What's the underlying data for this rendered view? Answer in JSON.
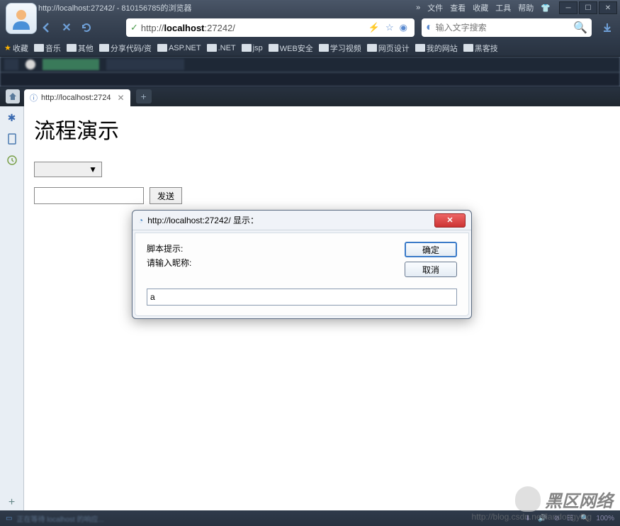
{
  "window": {
    "title": "http://localhost:27242/ - 810156785的浏览器"
  },
  "menu": {
    "arrow": "»",
    "file": "文件",
    "view": "查看",
    "favorites": "收藏",
    "tools": "工具",
    "help": "帮助"
  },
  "address": {
    "prefix": "http://",
    "host": "localhost",
    "rest": ":27242/"
  },
  "search": {
    "placeholder": "输入文字搜索"
  },
  "bookmarks": {
    "fav": "收藏",
    "items": [
      "音乐",
      "其他",
      "分享代码/资",
      "ASP.NET",
      ".NET",
      "jsp",
      "WEB安全",
      "学习视频",
      "网页设计",
      "我的网站",
      "黑客技"
    ]
  },
  "tab": {
    "label": "http://localhost:2724"
  },
  "page": {
    "heading": "流程演示",
    "send": "发送"
  },
  "dialog": {
    "title": "http://localhost:27242/ 显示：",
    "line1": "脚本提示:",
    "line2": "请输入昵称:",
    "ok": "确定",
    "cancel": "取消",
    "input": "a"
  },
  "watermark": {
    "text": "黑区网络",
    "url": "http://blog.csdn.net/landongying"
  },
  "status": {
    "zoom": "100%"
  }
}
